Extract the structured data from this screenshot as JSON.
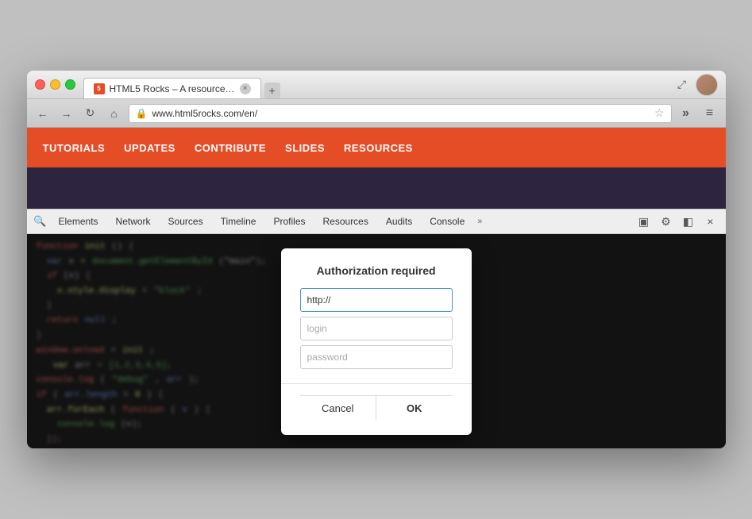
{
  "window": {
    "title": "HTML5 Rocks – A resource…",
    "url": "www.html5rocks.com/en/"
  },
  "traffic_lights": {
    "close": "close",
    "minimize": "minimize",
    "maximize": "maximize"
  },
  "tab": {
    "favicon_label": "5",
    "title": "HTML5 Rocks – A resource…",
    "close_label": "×"
  },
  "nav_buttons": {
    "back": "←",
    "forward": "→",
    "refresh": "↻",
    "home": "⌂",
    "more": "≡",
    "expand": "⤢"
  },
  "site_nav": {
    "items": [
      "TUTORIALS",
      "UPDATES",
      "CONTRIBUTE",
      "SLIDES",
      "RESOURCES"
    ]
  },
  "devtools": {
    "tabs": [
      "Elements",
      "Network",
      "Sources",
      "Timeline",
      "Profiles",
      "Resources",
      "Audits",
      "Console"
    ],
    "more_label": "»",
    "icons": {
      "dock": "▣",
      "settings": "⚙",
      "inspect": "◧",
      "close": "×"
    }
  },
  "modal": {
    "title": "Authorization required",
    "url_value": "http://",
    "login_placeholder": "login",
    "password_placeholder": "password",
    "cancel_label": "Cancel",
    "ok_label": "OK"
  },
  "colors": {
    "site_nav_bg": "#e44d26",
    "site_banner_bg": "#2d2540"
  }
}
